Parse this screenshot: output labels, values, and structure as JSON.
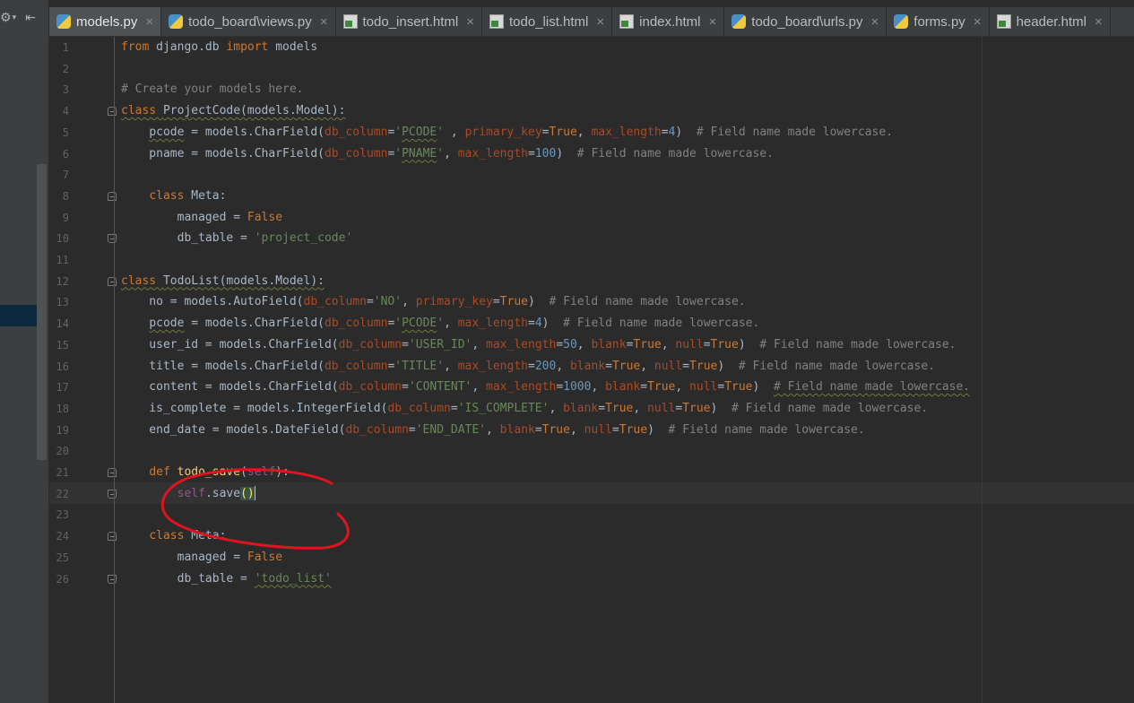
{
  "tabs": [
    {
      "label": "models.py",
      "type": "py",
      "active": true
    },
    {
      "label": "todo_board\\views.py",
      "type": "py",
      "active": false
    },
    {
      "label": "todo_insert.html",
      "type": "html",
      "active": false
    },
    {
      "label": "todo_list.html",
      "type": "html",
      "active": false
    },
    {
      "label": "index.html",
      "type": "html",
      "active": false
    },
    {
      "label": "todo_board\\urls.py",
      "type": "py",
      "active": false
    },
    {
      "label": "forms.py",
      "type": "py",
      "active": false
    },
    {
      "label": "header.html",
      "type": "html",
      "active": false
    }
  ],
  "close_glyph": "×",
  "toolbar": {
    "settings_icon": "gear-icon",
    "settings_glyph": "⚙",
    "settings_arrow": "▾",
    "collapse_icon": "collapse-left-icon",
    "collapse_glyph": "⇤"
  },
  "line_numbers": [
    "1",
    "2",
    "3",
    "4",
    "5",
    "6",
    "7",
    "8",
    "9",
    "10",
    "11",
    "12",
    "13",
    "14",
    "15",
    "16",
    "17",
    "18",
    "19",
    "20",
    "21",
    "22",
    "23",
    "24",
    "25",
    "26"
  ],
  "code_lines": [
    [
      [
        "kw",
        "from "
      ],
      [
        "",
        "django.db "
      ],
      [
        "kw",
        "import "
      ],
      [
        "",
        "models"
      ]
    ],
    [],
    [
      [
        "cmt",
        "# Create your models here."
      ]
    ],
    [
      [
        "kw warn",
        "class "
      ],
      [
        "warn",
        "ProjectCode(models.Model):"
      ]
    ],
    [
      [
        "",
        "    "
      ],
      [
        "warn",
        "pcode"
      ],
      [
        "",
        " = models.CharField("
      ],
      [
        "param",
        "db_column"
      ],
      [
        "",
        "="
      ],
      [
        "str",
        "'"
      ],
      [
        "str warn",
        "PCODE"
      ],
      [
        "str",
        "'"
      ],
      [
        "",
        " , "
      ],
      [
        "param",
        "primary_key"
      ],
      [
        "",
        "="
      ],
      [
        "kw",
        "True"
      ],
      [
        "",
        ", "
      ],
      [
        "param",
        "max_length"
      ],
      [
        "",
        "="
      ],
      [
        "num",
        "4"
      ],
      [
        "",
        ")  "
      ],
      [
        "cmt",
        "# Field name made lowercase."
      ]
    ],
    [
      [
        "",
        "    pname = models.CharField("
      ],
      [
        "param",
        "db_column"
      ],
      [
        "",
        "="
      ],
      [
        "str",
        "'"
      ],
      [
        "str warn",
        "PNAME"
      ],
      [
        "str",
        "'"
      ],
      [
        "",
        ", "
      ],
      [
        "param",
        "max_length"
      ],
      [
        "",
        "="
      ],
      [
        "num",
        "100"
      ],
      [
        "",
        ")  "
      ],
      [
        "cmt",
        "# Field name made lowercase."
      ]
    ],
    [],
    [
      [
        "",
        "    "
      ],
      [
        "kw",
        "class "
      ],
      [
        "",
        "Meta:"
      ]
    ],
    [
      [
        "",
        "        managed = "
      ],
      [
        "kw",
        "False"
      ]
    ],
    [
      [
        "",
        "        db_table = "
      ],
      [
        "str",
        "'project_code'"
      ]
    ],
    [],
    [
      [
        "kw warn",
        "class "
      ],
      [
        "warn",
        "TodoList(models.Model):"
      ]
    ],
    [
      [
        "",
        "    no = models.AutoField("
      ],
      [
        "param",
        "db_column"
      ],
      [
        "",
        "="
      ],
      [
        "str",
        "'NO'"
      ],
      [
        "",
        ", "
      ],
      [
        "param",
        "primary_key"
      ],
      [
        "",
        "="
      ],
      [
        "kw",
        "True"
      ],
      [
        "",
        ")  "
      ],
      [
        "cmt",
        "# Field name made lowercase."
      ]
    ],
    [
      [
        "",
        "    "
      ],
      [
        "warn",
        "pcode"
      ],
      [
        "",
        " = models.CharField("
      ],
      [
        "param",
        "db_column"
      ],
      [
        "",
        "="
      ],
      [
        "str",
        "'"
      ],
      [
        "str warn",
        "PCODE"
      ],
      [
        "str",
        "'"
      ],
      [
        "",
        ", "
      ],
      [
        "param",
        "max_length"
      ],
      [
        "",
        "="
      ],
      [
        "num",
        "4"
      ],
      [
        "",
        ")  "
      ],
      [
        "cmt",
        "# Field name made lowercase."
      ]
    ],
    [
      [
        "",
        "    user_id = models.CharField("
      ],
      [
        "param",
        "db_column"
      ],
      [
        "",
        "="
      ],
      [
        "str",
        "'USER_ID'"
      ],
      [
        "",
        ", "
      ],
      [
        "param",
        "max_length"
      ],
      [
        "",
        "="
      ],
      [
        "num",
        "50"
      ],
      [
        "",
        ", "
      ],
      [
        "param",
        "blank"
      ],
      [
        "",
        "="
      ],
      [
        "kw",
        "True"
      ],
      [
        "",
        ", "
      ],
      [
        "param",
        "null"
      ],
      [
        "",
        "="
      ],
      [
        "kw",
        "True"
      ],
      [
        "",
        ")  "
      ],
      [
        "cmt",
        "# Field name made lowercase."
      ]
    ],
    [
      [
        "",
        "    title = models.CharField("
      ],
      [
        "param",
        "db_column"
      ],
      [
        "",
        "="
      ],
      [
        "str",
        "'TITLE'"
      ],
      [
        "",
        ", "
      ],
      [
        "param",
        "max_length"
      ],
      [
        "",
        "="
      ],
      [
        "num",
        "200"
      ],
      [
        "",
        ", "
      ],
      [
        "param",
        "blank"
      ],
      [
        "",
        "="
      ],
      [
        "kw",
        "True"
      ],
      [
        "",
        ", "
      ],
      [
        "param",
        "null"
      ],
      [
        "",
        "="
      ],
      [
        "kw",
        "True"
      ],
      [
        "",
        ")  "
      ],
      [
        "cmt",
        "# Field name made lowercase."
      ]
    ],
    [
      [
        "",
        "    content = models.CharField("
      ],
      [
        "param",
        "db_column"
      ],
      [
        "",
        "="
      ],
      [
        "str",
        "'CONTENT'"
      ],
      [
        "",
        ", "
      ],
      [
        "param",
        "max_length"
      ],
      [
        "",
        "="
      ],
      [
        "num",
        "1000"
      ],
      [
        "",
        ", "
      ],
      [
        "param",
        "blank"
      ],
      [
        "",
        "="
      ],
      [
        "kw",
        "True"
      ],
      [
        "",
        ", "
      ],
      [
        "param",
        "null"
      ],
      [
        "",
        "="
      ],
      [
        "kw",
        "True"
      ],
      [
        "",
        ")  "
      ],
      [
        "cmt warn",
        "# Field name made lowercase."
      ]
    ],
    [
      [
        "",
        "    is_complete = models.IntegerField("
      ],
      [
        "param",
        "db_column"
      ],
      [
        "",
        "="
      ],
      [
        "str",
        "'IS_COMPLETE'"
      ],
      [
        "",
        ", "
      ],
      [
        "param",
        "blank"
      ],
      [
        "",
        "="
      ],
      [
        "kw",
        "True"
      ],
      [
        "",
        ", "
      ],
      [
        "param",
        "null"
      ],
      [
        "",
        "="
      ],
      [
        "kw",
        "True"
      ],
      [
        "",
        ")  "
      ],
      [
        "cmt",
        "# Field name made lowercase."
      ]
    ],
    [
      [
        "",
        "    end_date = models.DateField("
      ],
      [
        "param",
        "db_column"
      ],
      [
        "",
        "="
      ],
      [
        "str",
        "'END_DATE'"
      ],
      [
        "",
        ", "
      ],
      [
        "param",
        "blank"
      ],
      [
        "",
        "="
      ],
      [
        "kw",
        "True"
      ],
      [
        "",
        ", "
      ],
      [
        "param",
        "null"
      ],
      [
        "",
        "="
      ],
      [
        "kw",
        "True"
      ],
      [
        "",
        ")  "
      ],
      [
        "cmt",
        "# Field name made lowercase."
      ]
    ],
    [],
    [
      [
        "",
        "    "
      ],
      [
        "kw",
        "def "
      ],
      [
        "fn",
        "todo_save"
      ],
      [
        "",
        "("
      ],
      [
        "self",
        "self"
      ],
      [
        "",
        "):"
      ]
    ],
    [
      [
        "",
        "        "
      ],
      [
        "self",
        "self"
      ],
      [
        "",
        ".save"
      ],
      [
        "brace-hl",
        "()"
      ],
      [
        "cursor",
        ""
      ]
    ],
    [],
    [
      [
        "",
        "    "
      ],
      [
        "kw",
        "class "
      ],
      [
        "",
        "Meta:"
      ]
    ],
    [
      [
        "",
        "        managed = "
      ],
      [
        "kw",
        "False"
      ]
    ],
    [
      [
        "",
        "        db_table = "
      ],
      [
        "str warn",
        "'todo_list'"
      ]
    ]
  ],
  "folds": [
    {
      "line": 4,
      "kind": "start"
    },
    {
      "line": 8,
      "kind": "start"
    },
    {
      "line": 10,
      "kind": "end"
    },
    {
      "line": 12,
      "kind": "start"
    },
    {
      "line": 21,
      "kind": "start"
    },
    {
      "line": 22,
      "kind": "end"
    },
    {
      "line": 24,
      "kind": "start"
    },
    {
      "line": 26,
      "kind": "end"
    }
  ],
  "colors": {
    "annotation": "#e0141e",
    "background": "#2b2b2b",
    "keyword": "#cc7832",
    "string": "#6a8759"
  }
}
